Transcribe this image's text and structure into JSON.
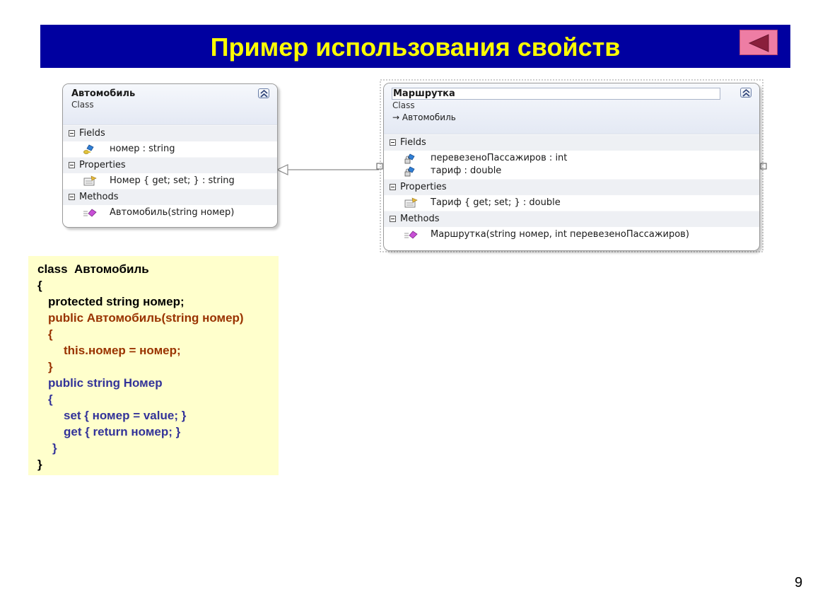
{
  "slide": {
    "title": "Пример использования свойств",
    "page_number": "9",
    "back_button": "back-arrow-icon"
  },
  "diagram": {
    "class1": {
      "name": "Автомобиль",
      "stereotype": "Class",
      "sections": {
        "fields": "Fields",
        "properties": "Properties",
        "methods": "Methods"
      },
      "fields": [
        "номер : string"
      ],
      "properties": [
        "Номер { get; set; } : string"
      ],
      "methods": [
        "Автомобиль(string номер)"
      ]
    },
    "class2": {
      "name": "Маршрутка",
      "stereotype": "Class",
      "base": "→ Автомобиль",
      "sections": {
        "fields": "Fields",
        "properties": "Properties",
        "methods": "Methods"
      },
      "fields": [
        "перевезеноПассажиров : int",
        "тариф : double"
      ],
      "properties": [
        "Тариф { get; set; } : double"
      ],
      "methods": [
        "Маршрутка(string номер, int перевезеноПассажиров)"
      ]
    },
    "relation": "inheritance"
  },
  "code": {
    "lines": [
      "class  Автомобиль",
      "{",
      "protected string номер;",
      "public Автомобиль(string номер)",
      "{",
      "this.номер = номер;",
      "}",
      "public string Номер",
      "{",
      "set { номер = value; }",
      "get { return номер; }",
      "}",
      "}"
    ],
    "colors": {
      "keyword": "#000000",
      "constructor": "#993300",
      "property": "#333399",
      "background": "#ffffcc"
    }
  },
  "colors": {
    "title_bar": "#0000a0",
    "title_text": "#ffff00",
    "back_button": "#ee7da4"
  }
}
